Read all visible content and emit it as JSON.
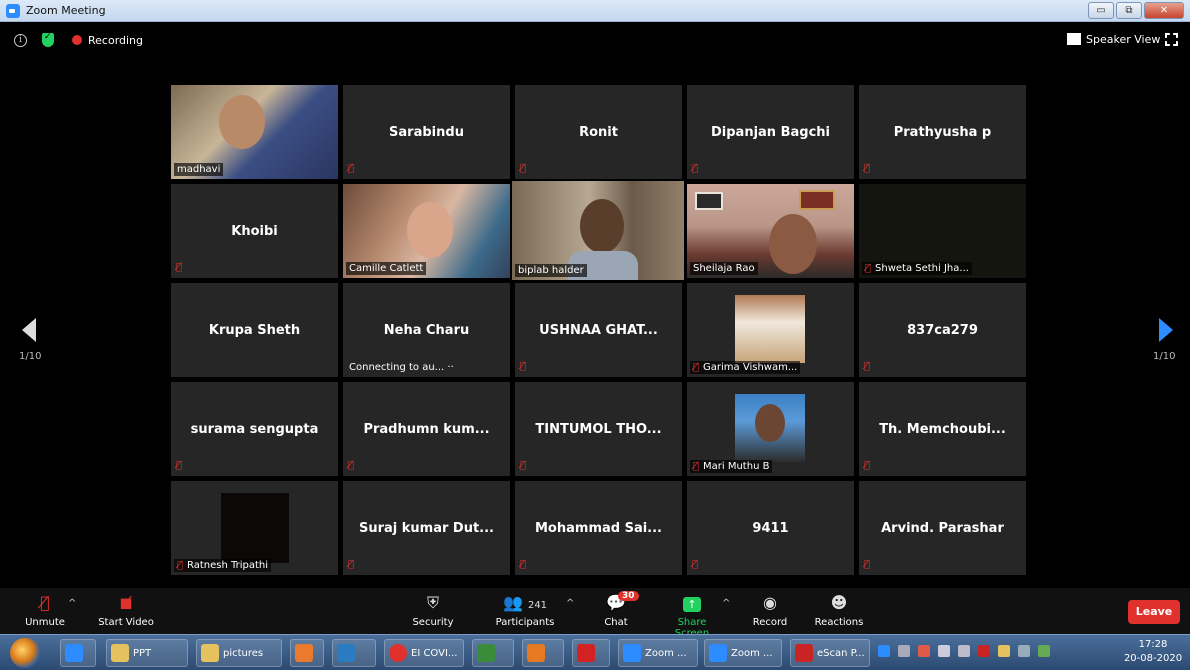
{
  "window": {
    "title": "Zoom Meeting",
    "min": "▭",
    "max": "⧉",
    "close": "✕"
  },
  "top": {
    "info_glyph": "i",
    "recording": "Recording",
    "speaker_view": "Speaker View"
  },
  "pager": {
    "left": "1/10",
    "right": "1/10"
  },
  "tiles": {
    "madhavi": "madhavi",
    "sarabindu": "Sarabindu",
    "ronit": "Ronit",
    "dipanjan": "Dipanjan Bagchi",
    "prathyusha": "Prathyusha p",
    "khoibi": "Khoibi",
    "camille": "Camille Catlett",
    "biplab": "biplab halder",
    "sheilaja": "Sheilaja Rao",
    "shweta": "Shweta Sethi Jha...",
    "krupa": "Krupa Sheth",
    "neha": "Neha Charu",
    "neha_status": "Connecting to au... ··",
    "ushnaa": "USHNAA GHAT...",
    "garima": "Garima Vishwam...",
    "c837": "837ca279",
    "surama": "surama sengupta",
    "pradhumn": "Pradhumn kum...",
    "tintumol": "TINTUMOL THO...",
    "mari": "Mari Muthu B",
    "memchoubi": "Th. Memchoubi...",
    "ratnesh": "Ratnesh Tripathi",
    "suraj": "Suraj kumar Dut...",
    "mohammad": "Mohammad Sai...",
    "n9411": "9411",
    "arvind": "Arvind. Parashar"
  },
  "toolbar": {
    "unmute": "Unmute",
    "start_video": "Start Video",
    "security": "Security",
    "participants": "Participants",
    "participants_count": "241",
    "chat": "Chat",
    "chat_badge": "30",
    "share_screen": "Share Screen",
    "record": "Record",
    "reactions": "Reactions",
    "leave": "Leave"
  },
  "taskbar": {
    "ppt": "PPT",
    "pictures": "pictures",
    "chrome": "EI COVI...",
    "zoom1": "Zoom ...",
    "zoom2": "Zoom ...",
    "escan": "eScan P...",
    "time": "17:28",
    "date": "20-08-2020"
  },
  "colors": {
    "accent": "#2d8cff",
    "mute_red": "#e0312c",
    "green": "#23d160",
    "active_border": "#b4e05a"
  }
}
